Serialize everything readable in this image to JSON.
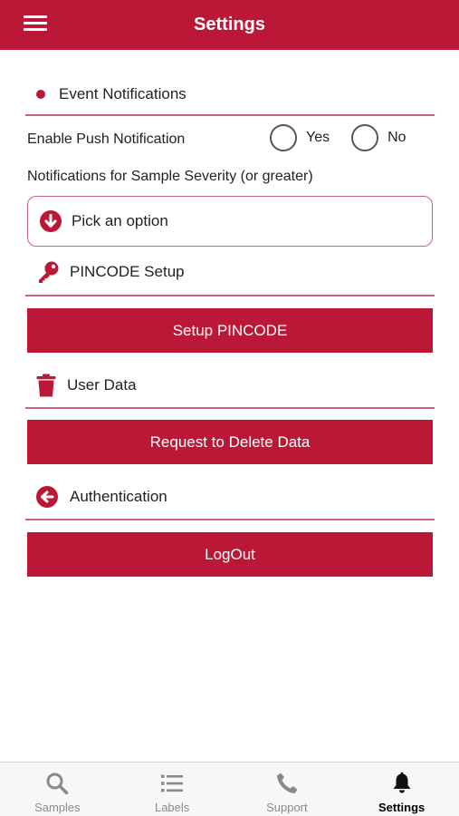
{
  "header": {
    "title": "Settings"
  },
  "event_notifications": {
    "title": "Event Notifications",
    "push_label": "Enable Push Notification",
    "yes_label": "Yes",
    "no_label": "No",
    "severity_label": "Notifications for Sample Severity (or greater)",
    "picker_placeholder": "Pick an option"
  },
  "pincode": {
    "title": "PINCODE Setup",
    "button_label": "Setup PINCODE"
  },
  "user_data": {
    "title": "User Data",
    "button_label": "Request to Delete Data"
  },
  "authentication": {
    "title": "Authentication",
    "button_label": "LogOut"
  },
  "tabbar": {
    "items": [
      {
        "label": "Samples",
        "icon": "search-icon"
      },
      {
        "label": "Labels",
        "icon": "list-icon"
      },
      {
        "label": "Support",
        "icon": "phone-icon"
      },
      {
        "label": "Settings",
        "icon": "bell-icon"
      }
    ],
    "active": "Settings"
  },
  "colors": {
    "accent": "#bb1837",
    "divider": "#c9627a",
    "tabbar_bg": "#f7f7f7"
  }
}
